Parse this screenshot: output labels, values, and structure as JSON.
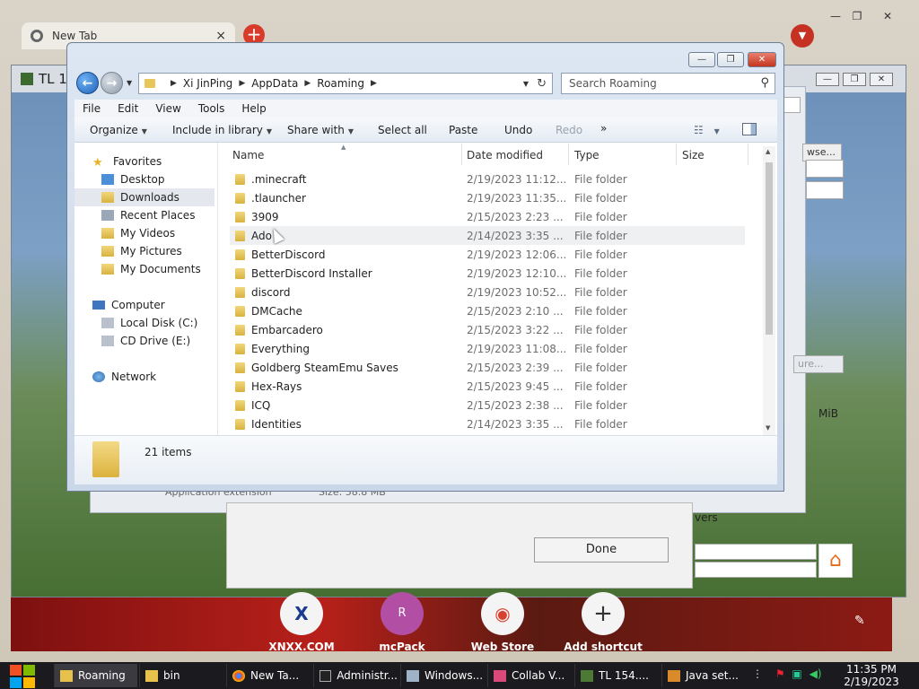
{
  "browser": {
    "tab_title": "New Tab",
    "tab_close": "×",
    "new_tab": "+",
    "shortcuts": [
      {
        "label": "XNXX.COM",
        "glyph": "X"
      },
      {
        "label": "mcPack",
        "glyph": "R"
      },
      {
        "label": "Web Store",
        "glyph": "◉"
      },
      {
        "label": "Add shortcut",
        "glyph": "+"
      }
    ]
  },
  "launcher": {
    "title": "TL 1",
    "browse": "wse...",
    "configure": "ure...",
    "unit": "MiB",
    "servers": "vers",
    "done": "Done",
    "extension_label": "Application extension",
    "size_label": "Size: 58.8 MB"
  },
  "explorer": {
    "breadcrumb": [
      "Xi JinPing",
      "AppData",
      "Roaming"
    ],
    "search_placeholder": "Search Roaming",
    "menu": [
      "File",
      "Edit",
      "View",
      "Tools",
      "Help"
    ],
    "toolbar": {
      "organize": "Organize",
      "include": "Include in library",
      "share": "Share with",
      "select_all": "Select all",
      "paste": "Paste",
      "undo": "Undo",
      "redo": "Redo",
      "more": "»"
    },
    "nav": {
      "favorites": "Favorites",
      "desktop": "Desktop",
      "downloads": "Downloads",
      "recent": "Recent Places",
      "videos": "My Videos",
      "pictures": "My Pictures",
      "documents": "My Documents",
      "computer": "Computer",
      "local_disk": "Local Disk (C:)",
      "cd_drive": "CD Drive (E:)",
      "network": "Network"
    },
    "columns": {
      "name": "Name",
      "date": "Date modified",
      "type": "Type",
      "size": "Size"
    },
    "files": [
      {
        "name": ".minecraft",
        "date": "2/19/2023 11:12...",
        "type": "File folder"
      },
      {
        "name": ".tlauncher",
        "date": "2/19/2023 11:35...",
        "type": "File folder"
      },
      {
        "name": "3909",
        "date": "2/15/2023 2:23 ...",
        "type": "File folder"
      },
      {
        "name": "Ado",
        "date": "2/14/2023 3:35 ...",
        "type": "File folder"
      },
      {
        "name": "BetterDiscord",
        "date": "2/19/2023 12:06...",
        "type": "File folder"
      },
      {
        "name": "BetterDiscord Installer",
        "date": "2/19/2023 12:10...",
        "type": "File folder"
      },
      {
        "name": "discord",
        "date": "2/19/2023 10:52...",
        "type": "File folder"
      },
      {
        "name": "DMCache",
        "date": "2/15/2023 2:10 ...",
        "type": "File folder"
      },
      {
        "name": "Embarcadero",
        "date": "2/15/2023 3:22 ...",
        "type": "File folder"
      },
      {
        "name": "Everything",
        "date": "2/19/2023 11:08...",
        "type": "File folder"
      },
      {
        "name": "Goldberg SteamEmu Saves",
        "date": "2/15/2023 2:39 ...",
        "type": "File folder"
      },
      {
        "name": "Hex-Rays",
        "date": "2/15/2023 9:45 ...",
        "type": "File folder"
      },
      {
        "name": "ICQ",
        "date": "2/15/2023 2:38 ...",
        "type": "File folder"
      },
      {
        "name": "Identities",
        "date": "2/14/2023 3:35 ...",
        "type": "File folder"
      }
    ],
    "items_count": "21 items"
  },
  "taskbar": {
    "buttons": [
      "Roaming",
      "bin",
      "New Ta...",
      "Administr...",
      "Windows...",
      "Collab V...",
      "TL 154....",
      "Java set..."
    ],
    "time": "11:35 PM",
    "date": "2/19/2023"
  }
}
